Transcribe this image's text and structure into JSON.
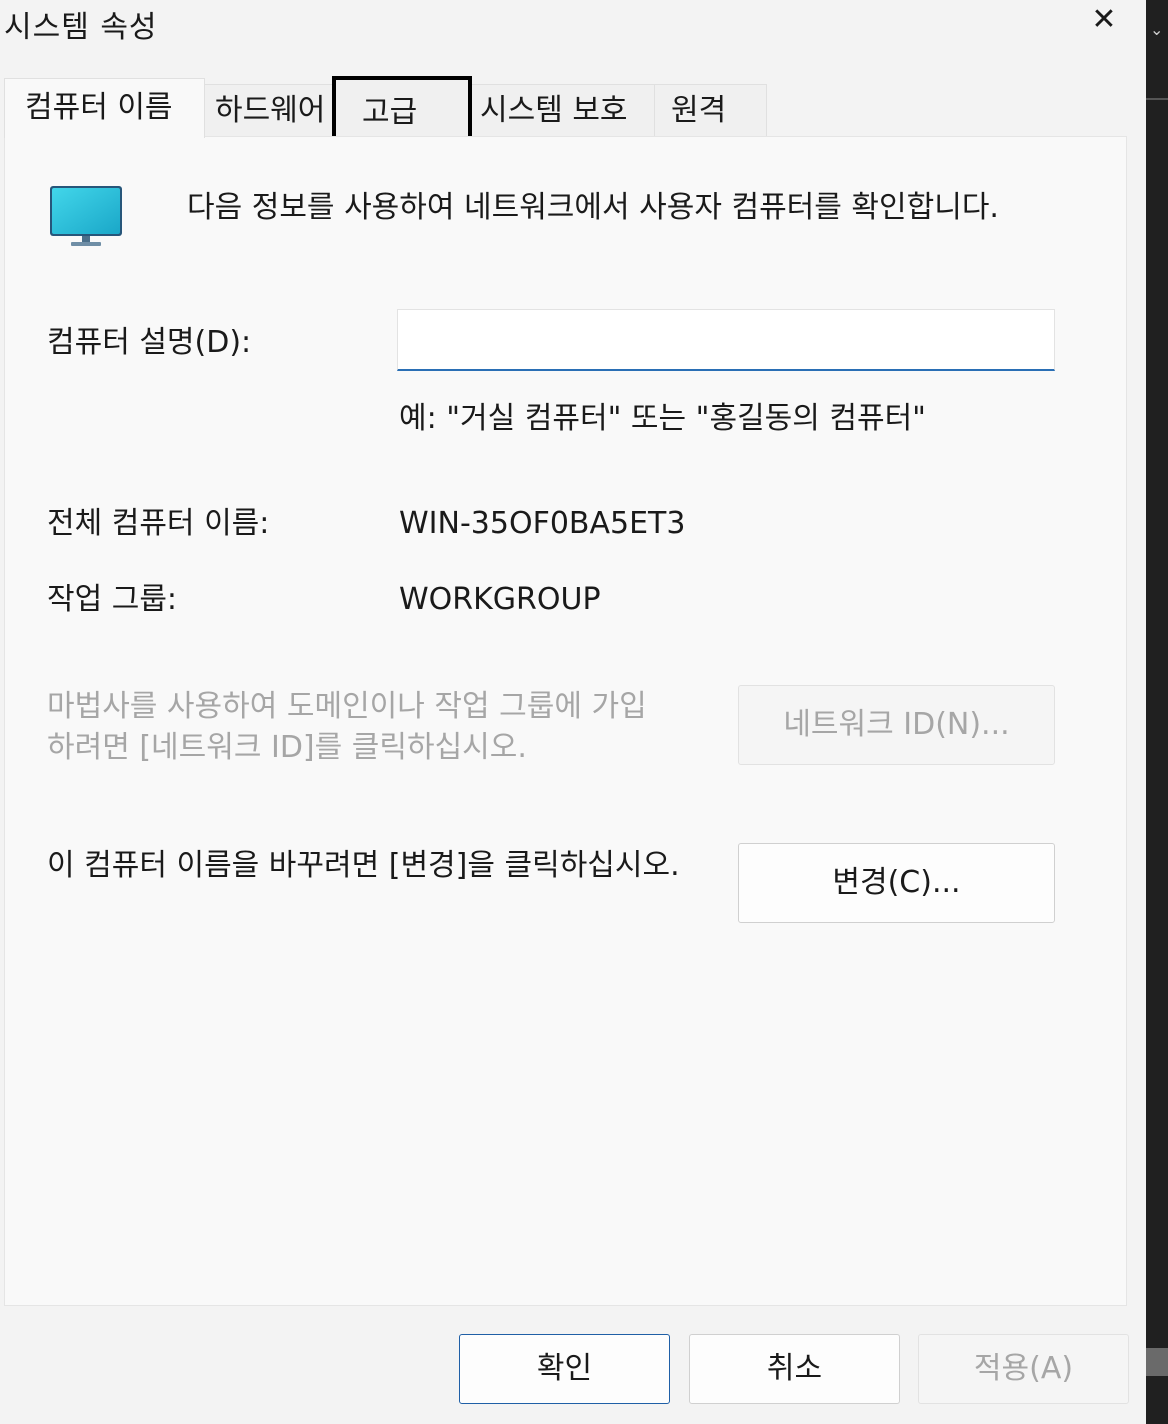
{
  "window": {
    "title": "시스템 속성",
    "close_glyph": "✕"
  },
  "tabs": [
    {
      "label": "컴퓨터 이름"
    },
    {
      "label": "하드웨어"
    },
    {
      "label": "고급"
    },
    {
      "label": "시스템 보호"
    },
    {
      "label": "원격"
    }
  ],
  "active_tab": "컴퓨터 이름",
  "focused_tab": "고급",
  "computer_name": {
    "intro_text": "다음 정보를 사용하여 네트워크에서 사용자 컴퓨터를 확인합니다.",
    "description_label": "컴퓨터 설명(D):",
    "description_value": "",
    "description_example": "예: \"거실 컴퓨터\" 또는 \"홍길동의 컴퓨터\"",
    "full_name_label": "전체 컴퓨터 이름:",
    "full_name_value": "WIN-35OF0BA5ET3",
    "workgroup_label": "작업 그룹:",
    "workgroup_value": "WORKGROUP",
    "network_id_text": "마법사를 사용하여 도메인이나 작업 그룹에 가입하려면 [네트워크 ID]를 클릭하십시오.",
    "network_id_button": "네트워크 ID(N)...",
    "change_text": "이 컴퓨터 이름을 바꾸려면 [변경]을 클릭하십시오.",
    "change_button": "변경(C)..."
  },
  "footer": {
    "ok_button": "확인",
    "cancel_button": "취소",
    "apply_button": "적용(A)"
  },
  "icons": {
    "computer": "monitor-icon",
    "close": "close-icon"
  },
  "colors": {
    "accent": "#2a6fb5",
    "disabled_text": "#a6a6a6",
    "monitor_screen": "#2ec6e0"
  }
}
